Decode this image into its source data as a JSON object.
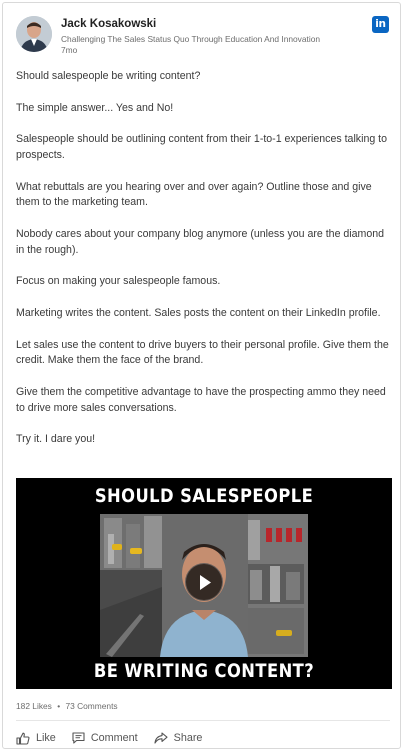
{
  "post": {
    "author_name": "Jack Kosakowski",
    "author_tagline": "Challenging The Sales Status Quo Through Education And Innovation",
    "time_ago": "7mo",
    "network_logo": "in",
    "paragraphs": [
      "Should salespeople be writing content?",
      "The simple answer... Yes and No!",
      "Salespeople should be outlining content from their 1-to-1 experiences talking to prospects.",
      "What rebuttals are you hearing over and over again? Outline those and give them to the marketing team.",
      "Nobody cares about your company blog anymore (unless you are the diamond in the rough).",
      "Focus on making your salespeople famous.",
      "Marketing writes the content. Sales posts the content on their LinkedIn profile.",
      "Let sales use the content to drive buyers to their personal profile. Give them the credit. Make them the face of the brand.",
      "Give them the competitive advantage to have the prospecting ammo they need to drive more sales conversations.",
      "Try it. I dare you!"
    ]
  },
  "video": {
    "title_top": "SHOULD SALESPEOPLE",
    "title_bottom": "BE WRITING CONTENT?",
    "play_icon": "play-icon"
  },
  "engagement": {
    "likes": "182 Likes",
    "separator": "•",
    "comments": "73 Comments"
  },
  "actions": {
    "like_label": "Like",
    "comment_label": "Comment",
    "share_label": "Share"
  },
  "colors": {
    "linkedin_blue": "#0a66c2",
    "text": "#3a3a3a",
    "muted": "#6d6d6d"
  }
}
